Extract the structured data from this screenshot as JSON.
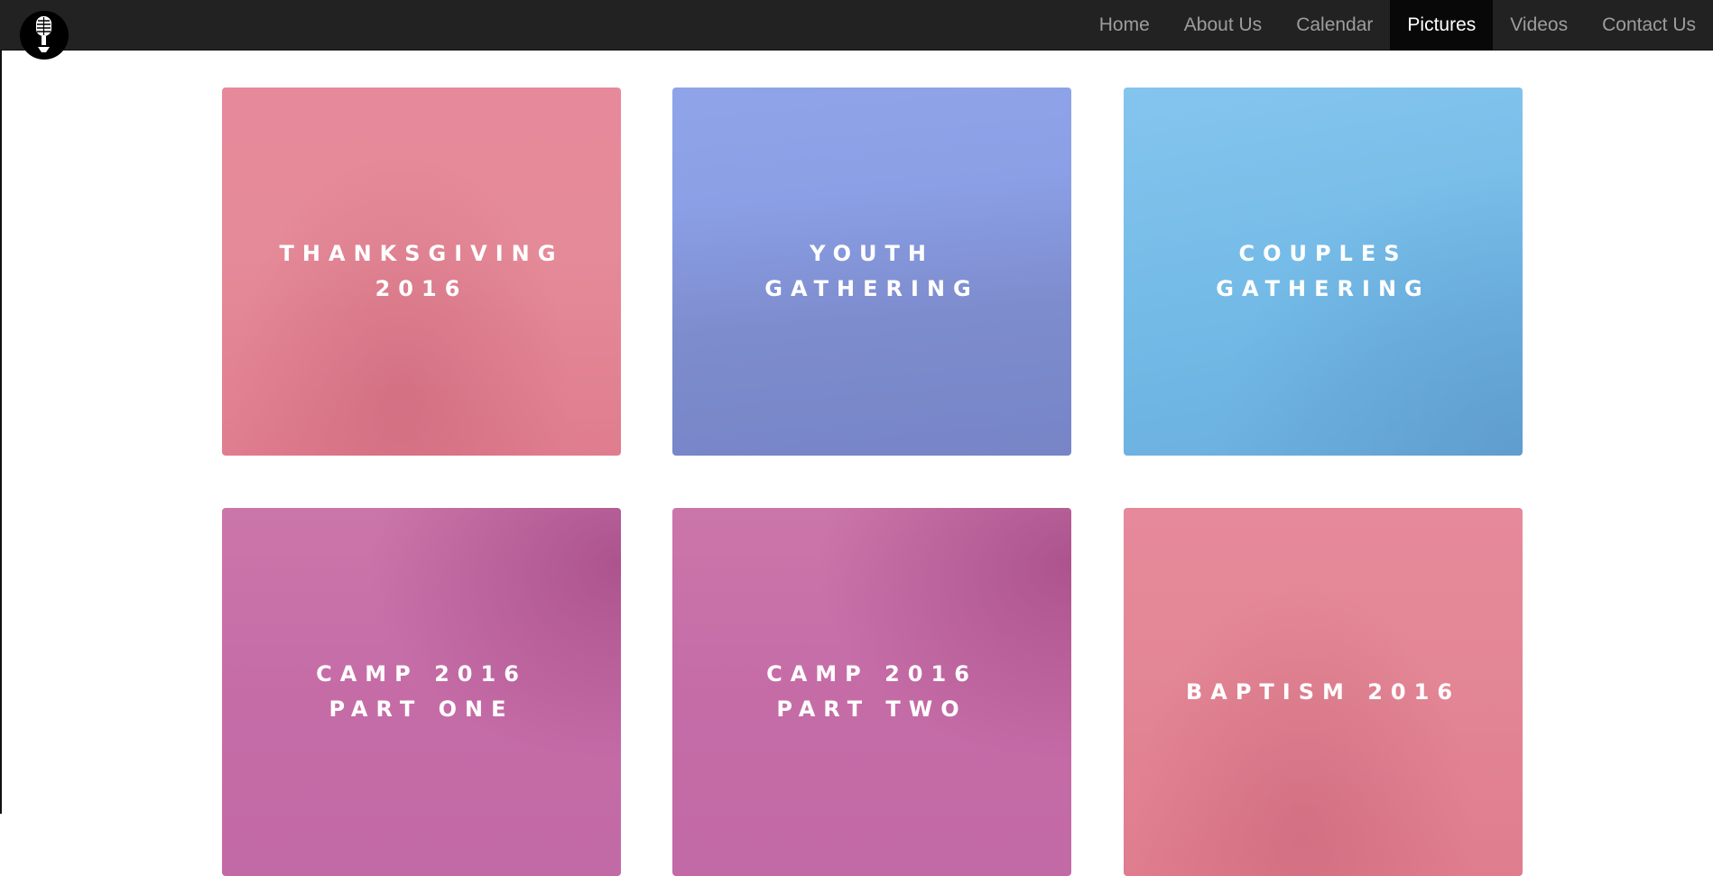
{
  "nav": {
    "logo_icon": "microphone-icon",
    "items": [
      {
        "label": "Home",
        "active": false
      },
      {
        "label": "About Us",
        "active": false
      },
      {
        "label": "Calendar",
        "active": false
      },
      {
        "label": "Pictures",
        "active": true
      },
      {
        "label": "Videos",
        "active": false
      },
      {
        "label": "Contact Us",
        "active": false
      }
    ]
  },
  "gallery": {
    "albums": [
      {
        "title": "THANKSGIVING 2016",
        "color": "#e58a98"
      },
      {
        "title": "YOUTH GATHERING",
        "color": "#8b9fe6"
      },
      {
        "title": "COUPLES GATHERING",
        "color": "#77bde8"
      },
      {
        "title": "CAMP 2016 PART ONE",
        "color": "#c56ca7"
      },
      {
        "title": "CAMP 2016 PART TWO",
        "color": "#c56ca7"
      },
      {
        "title": "BAPTISM 2016",
        "color": "#e38695"
      }
    ]
  }
}
